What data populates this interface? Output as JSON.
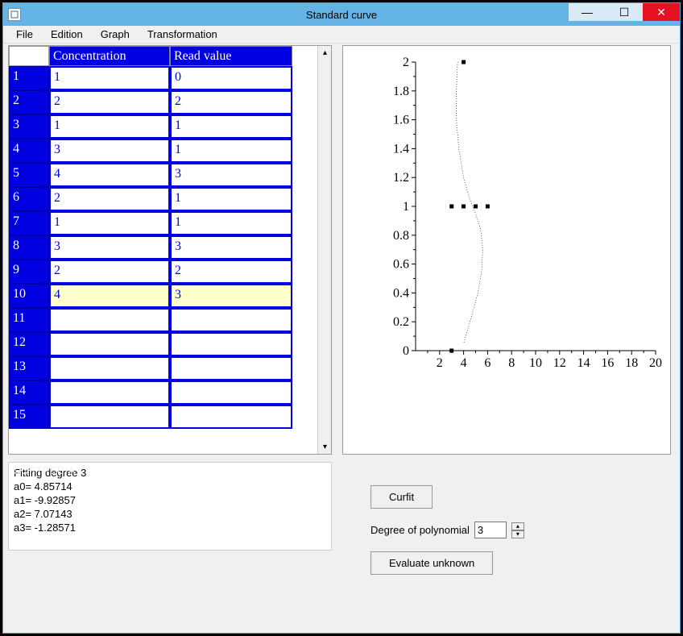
{
  "window": {
    "title": "Standard curve"
  },
  "menu": {
    "file": "File",
    "edition": "Edition",
    "graph": "Graph",
    "transformation": "Transformation"
  },
  "table": {
    "headers": {
      "concentration": "Concentration",
      "read_value": "Read value"
    },
    "selected_row": 10,
    "rows": [
      {
        "n": "1",
        "c": "1",
        "r": "0"
      },
      {
        "n": "2",
        "c": "2",
        "r": "2"
      },
      {
        "n": "3",
        "c": "1",
        "r": "1"
      },
      {
        "n": "4",
        "c": "3",
        "r": "1"
      },
      {
        "n": "5",
        "c": "4",
        "r": "3"
      },
      {
        "n": "6",
        "c": "2",
        "r": "1"
      },
      {
        "n": "7",
        "c": "1",
        "r": "1"
      },
      {
        "n": "8",
        "c": "3",
        "r": "3"
      },
      {
        "n": "9",
        "c": "2",
        "r": "2"
      },
      {
        "n": "10",
        "c": "4",
        "r": "3"
      },
      {
        "n": "11",
        "c": "",
        "r": ""
      },
      {
        "n": "12",
        "c": "",
        "r": ""
      },
      {
        "n": "13",
        "c": "",
        "r": ""
      },
      {
        "n": "14",
        "c": "",
        "r": ""
      },
      {
        "n": "15",
        "c": "",
        "r": ""
      }
    ]
  },
  "fit": {
    "heading": " Fitting degree 3",
    "a0": "a0= 4.85714",
    "a1": "a1= -9.92857",
    "a2": "a2= 7.07143",
    "a3": "a3= -1.28571"
  },
  "controls": {
    "curfit": "Curfit",
    "degree_label": "Degree of polynomial",
    "degree_value": "3",
    "evaluate": "Evaluate unknown"
  },
  "chart_data": {
    "type": "scatter",
    "title": "",
    "xlabel": "",
    "ylabel": "",
    "xlim": [
      0,
      20
    ],
    "ylim": [
      0,
      2
    ],
    "xticks": [
      2,
      4,
      6,
      8,
      10,
      12,
      14,
      16,
      18,
      20
    ],
    "yticks": [
      0,
      0.2,
      0.4,
      0.6,
      0.8,
      1,
      1.2,
      1.4,
      1.6,
      1.8,
      2
    ],
    "series": [
      {
        "name": "points",
        "type": "scatter",
        "x": [
          3,
          3,
          4,
          5,
          6,
          4
        ],
        "y": [
          0,
          1,
          1,
          1,
          1,
          2
        ]
      },
      {
        "name": "fit",
        "type": "line",
        "x": [
          3.5,
          3.4,
          3.4,
          3.6,
          4.0,
          4.5,
          5.0,
          5.4,
          5.6,
          5.5,
          5.2,
          4.7,
          4.0
        ],
        "y": [
          2.0,
          1.8,
          1.6,
          1.4,
          1.2,
          1.05,
          0.95,
          0.85,
          0.7,
          0.55,
          0.4,
          0.25,
          0.05
        ]
      }
    ]
  }
}
